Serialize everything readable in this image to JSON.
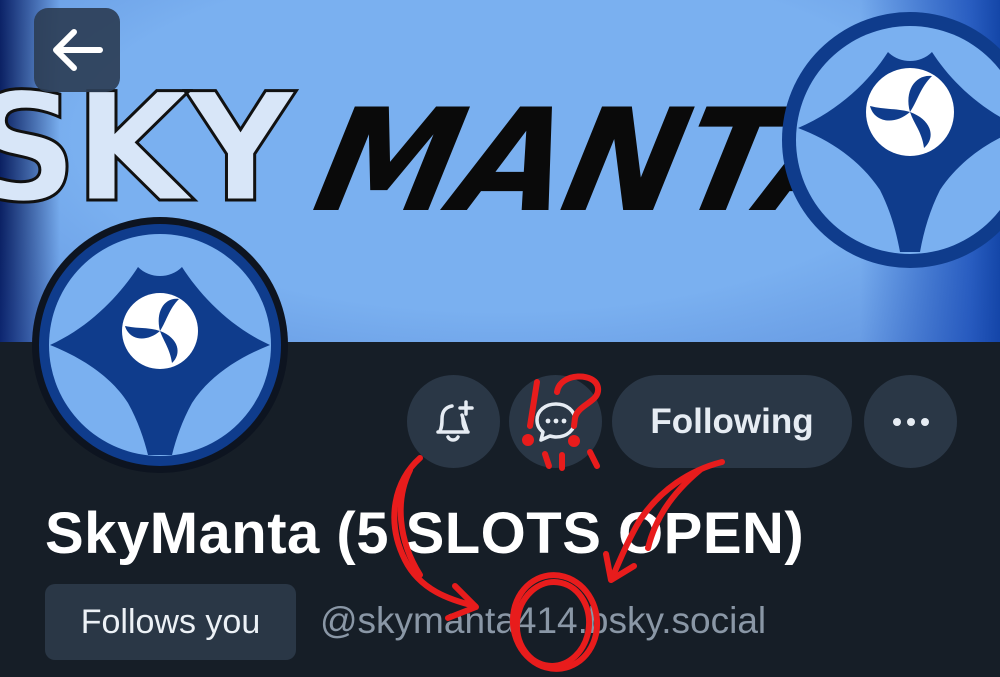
{
  "banner": {
    "title_left": "SKY",
    "title_main": "MANTA"
  },
  "nav": {
    "back_icon": "arrow-left-icon"
  },
  "actions": {
    "notify_icon": "bell-plus-icon",
    "message_icon": "chat-bubble-icon",
    "following_label": "Following",
    "more_icon": "ellipsis-icon"
  },
  "profile": {
    "display_name": "SkyManta (5 SLOTS OPEN)",
    "follows_you": "Follows you",
    "handle": "@skymanta414.bsky.social"
  },
  "annotation": {
    "question_mark": "?",
    "exclamation": "!",
    "color": "#e81c1c"
  },
  "colors": {
    "banner_blue": "#7ab0f0",
    "logo_navy": "#0f3c8c",
    "background": "#161e27",
    "button_bg": "#2a3746",
    "handle_text": "#8a97a6"
  }
}
